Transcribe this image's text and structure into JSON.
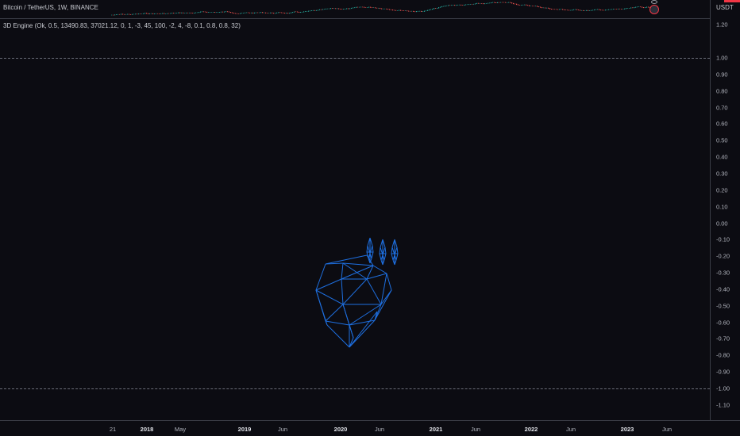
{
  "header": {
    "symbol_title": "Bitcoin / TetherUS, 1W, BINANCE",
    "currency": "USDT"
  },
  "indicator": {
    "label": "3D Engine (Ok, 0.5, 13490.83, 37021.12, 0, 1, -3, 45, 100, -2, 4, -8, 0.1, 0.8, 0.8, 32)"
  },
  "y_axis": {
    "ticks": [
      "1.20",
      "1.00",
      "0.90",
      "0.80",
      "0.70",
      "0.60",
      "0.50",
      "0.40",
      "0.30",
      "0.20",
      "0.10",
      "0.00",
      "-0.10",
      "-0.20",
      "-0.30",
      "-0.40",
      "-0.50",
      "-0.60",
      "-0.70",
      "-0.80",
      "-0.90",
      "-1.00",
      "-1.10"
    ],
    "values": [
      1.2,
      1.0,
      0.9,
      0.8,
      0.7,
      0.6,
      0.5,
      0.4,
      0.3,
      0.2,
      0.1,
      0.0,
      -0.1,
      -0.2,
      -0.3,
      -0.4,
      -0.5,
      -0.6,
      -0.7,
      -0.8,
      -0.9,
      -1.0,
      -1.1
    ],
    "dashed_levels": [
      1.0,
      -1.0
    ]
  },
  "x_axis": {
    "ticks": [
      {
        "label": "21",
        "bold": false
      },
      {
        "label": "2018",
        "bold": true
      },
      {
        "label": "May",
        "bold": false
      },
      {
        "label": "2019",
        "bold": true
      },
      {
        "label": "Jun",
        "bold": false
      },
      {
        "label": "2020",
        "bold": true
      },
      {
        "label": "Jun",
        "bold": false
      },
      {
        "label": "2021",
        "bold": true
      },
      {
        "label": "Jun",
        "bold": false
      },
      {
        "label": "2022",
        "bold": true
      },
      {
        "label": "Jun",
        "bold": false
      },
      {
        "label": "2023",
        "bold": true
      },
      {
        "label": "Jun",
        "bold": false
      }
    ]
  },
  "colors": {
    "background": "#0c0c12",
    "wireframe": "#1e6fe0",
    "up_candle": "#26a69a",
    "down_candle": "#ef5350",
    "alert": "#f23645"
  },
  "icons": [
    "alert-icon",
    "settings-icon"
  ]
}
